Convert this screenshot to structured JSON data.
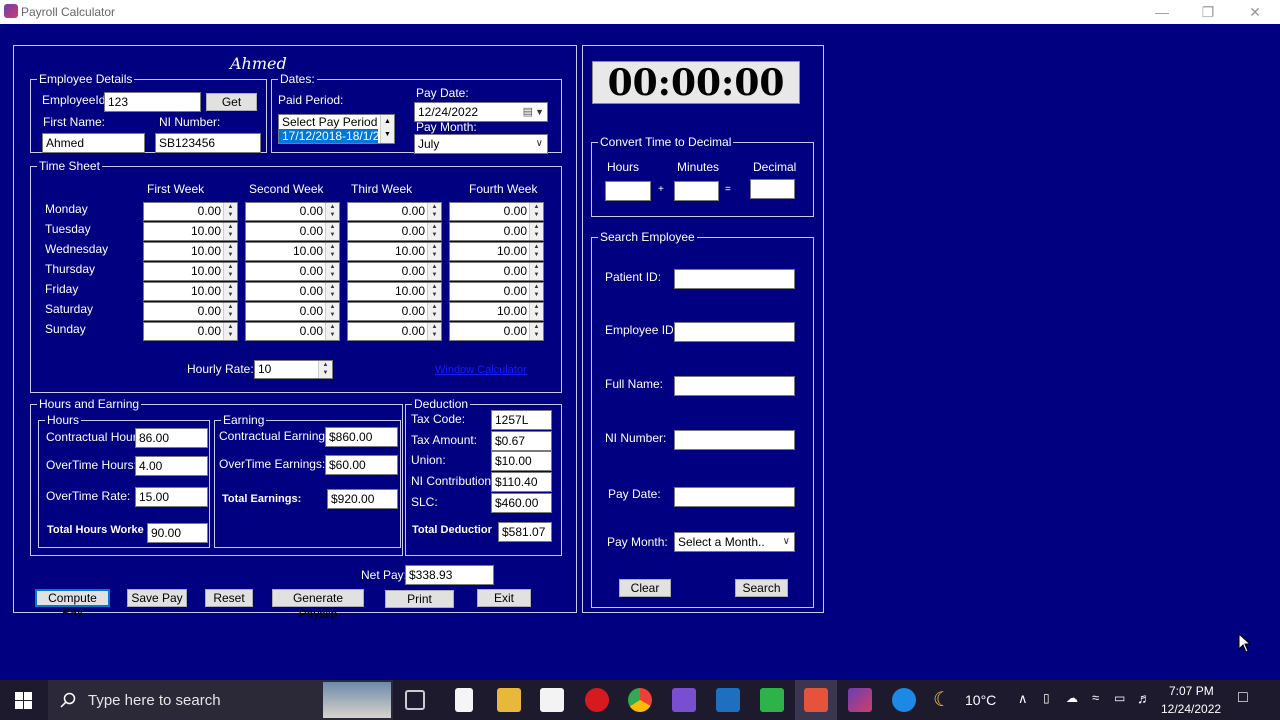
{
  "window": {
    "title": "Payroll Calculator"
  },
  "header": {
    "employee_name": "Ahmed"
  },
  "employee_details": {
    "legend": "Employee Details",
    "employee_id_label": "EmployeeId",
    "employee_id_value": "123",
    "get_button": "Get",
    "first_name_label": "First Name:",
    "first_name_value": "Ahmed",
    "ni_number_label": "NI Number:",
    "ni_number_value": "SB123456"
  },
  "dates": {
    "legend": "Dates:",
    "paid_period_label": "Paid Period:",
    "paid_period_options": [
      "Select Pay Period",
      "17/12/2018-18/1/2"
    ],
    "pay_date_label": "Pay Date:",
    "pay_date_value": "12/24/2022",
    "pay_month_label": "Pay Month:",
    "pay_month_value": "July"
  },
  "timesheet": {
    "legend": "Time Sheet",
    "weeks": [
      "First Week",
      "Second Week",
      "Third Week",
      "Fourth Week"
    ],
    "days": [
      "Monday",
      "Tuesday",
      "Wednesday",
      "Thursday",
      "Friday",
      "Saturday",
      "Sunday"
    ],
    "values": [
      [
        "0.00",
        "10.00",
        "10.00",
        "10.00",
        "10.00",
        "0.00",
        "0.00"
      ],
      [
        "0.00",
        "0.00",
        "10.00",
        "0.00",
        "0.00",
        "0.00",
        "0.00"
      ],
      [
        "0.00",
        "0.00",
        "10.00",
        "0.00",
        "10.00",
        "0.00",
        "0.00"
      ],
      [
        "0.00",
        "0.00",
        "10.00",
        "0.00",
        "0.00",
        "10.00",
        "0.00"
      ]
    ],
    "hourly_rate_label": "Hourly Rate:",
    "hourly_rate_value": "10",
    "link_text": "Window Calculator"
  },
  "hours_earning": {
    "legend": "Hours and Earning",
    "hours_legend": "Hours",
    "contractual_hours_label": "Contractual Hours:",
    "contractual_hours_value": "86.00",
    "overtime_hours_label": "OverTime Hours:",
    "overtime_hours_value": "4.00",
    "overtime_rate_label": "OverTime Rate:",
    "overtime_rate_value": "15.00",
    "total_hours_label": "Total Hours Worke",
    "total_hours_value": "90.00",
    "earning_legend": "Earning",
    "contractual_earnings_label": "Contractual Earnings:",
    "contractual_earnings_value": "$860.00",
    "overtime_earnings_label": "OverTime Earnings:",
    "overtime_earnings_value": "$60.00",
    "total_earnings_label": "Total Earnings:",
    "total_earnings_value": "$920.00"
  },
  "deduction": {
    "legend": "Deduction",
    "tax_code_label": "Tax Code:",
    "tax_code_value": "1257L",
    "tax_amount_label": "Tax Amount:",
    "tax_amount_value": "$0.67",
    "union_label": "Union:",
    "union_value": "$10.00",
    "ni_contribution_label": "NI Contribution:",
    "ni_contribution_value": "$110.40",
    "slc_label": "SLC:",
    "slc_value": "$460.00",
    "total_deduction_label": "Total Deductior",
    "total_deduction_value": "$581.07"
  },
  "net_pay": {
    "label": "Net Pay:",
    "value": "$338.93"
  },
  "actions": {
    "compute": "Compute Pay",
    "save": "Save Pay",
    "reset": "Reset",
    "payslip": "Generate Payslip",
    "print": "Print",
    "exit": "Exit"
  },
  "clock": {
    "value": "00:00:00"
  },
  "convert": {
    "legend": "Convert Time to Decimal",
    "hours_label": "Hours",
    "minutes_label": "Minutes",
    "decimal_label": "Decimal",
    "plus": "+",
    "equals": "="
  },
  "search": {
    "legend": "Search Employee",
    "patient_id_label": "Patient ID:",
    "employee_id_label": "Employee ID:",
    "full_name_label": "Full Name:",
    "ni_number_label": "NI Number:",
    "pay_date_label": "Pay Date:",
    "pay_month_label": "Pay Month:",
    "pay_month_value": "Select a Month..",
    "clear_button": "Clear",
    "search_button": "Search"
  },
  "taskbar": {
    "search_placeholder": "Type here to search",
    "weather": "10°C",
    "time": "7:07 PM",
    "date": "12/24/2022"
  },
  "colors": {
    "background": "#000080",
    "taskbar": "#1d1a2e",
    "accent": "#0078d7"
  }
}
